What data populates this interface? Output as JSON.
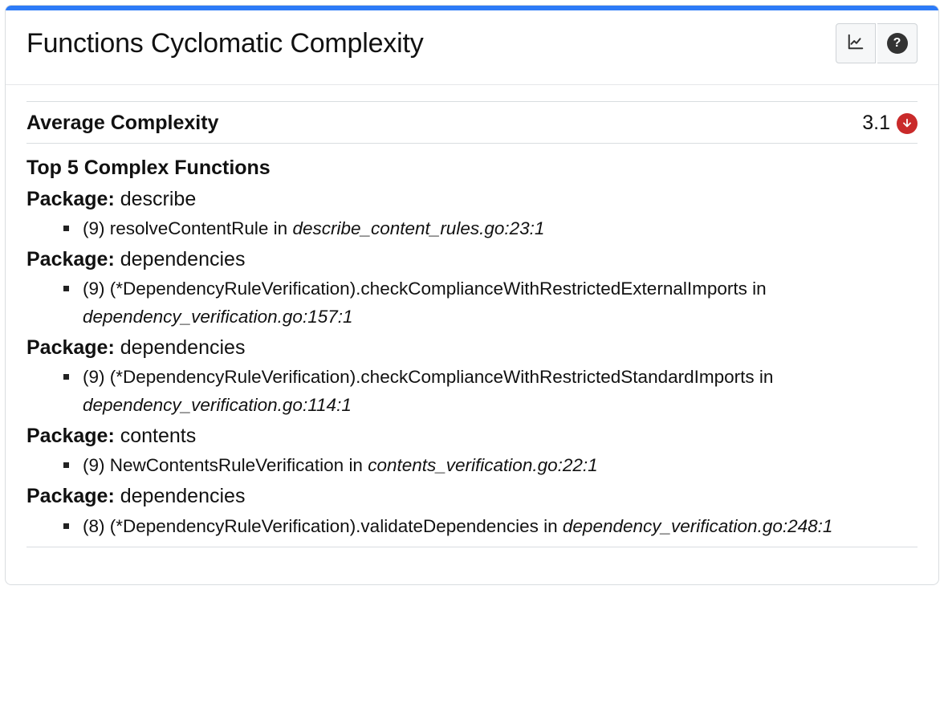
{
  "header": {
    "title": "Functions Cyclomatic Complexity"
  },
  "average": {
    "label": "Average Complexity",
    "value": "3.1",
    "trend": "down"
  },
  "topSection": {
    "title": "Top 5 Complex Functions",
    "packageLabel": "Package:",
    "items": [
      {
        "package": "describe",
        "score": "9",
        "func": "resolveContentRule",
        "in": "in",
        "location": "describe_content_rules.go:23:1"
      },
      {
        "package": "dependencies",
        "score": "9",
        "func": "(*DependencyRuleVerification).checkComplianceWithRestrictedExternalImports",
        "in": "in",
        "location": "dependency_verification.go:157:1"
      },
      {
        "package": "dependencies",
        "score": "9",
        "func": "(*DependencyRuleVerification).checkComplianceWithRestrictedStandardImports",
        "in": "in",
        "location": "dependency_verification.go:114:1"
      },
      {
        "package": "contents",
        "score": "9",
        "func": "NewContentsRuleVerification",
        "in": "in",
        "location": "contents_verification.go:22:1"
      },
      {
        "package": "dependencies",
        "score": "8",
        "func": "(*DependencyRuleVerification).validateDependencies",
        "in": "in",
        "location": "dependency_verification.go:248:1"
      }
    ]
  }
}
